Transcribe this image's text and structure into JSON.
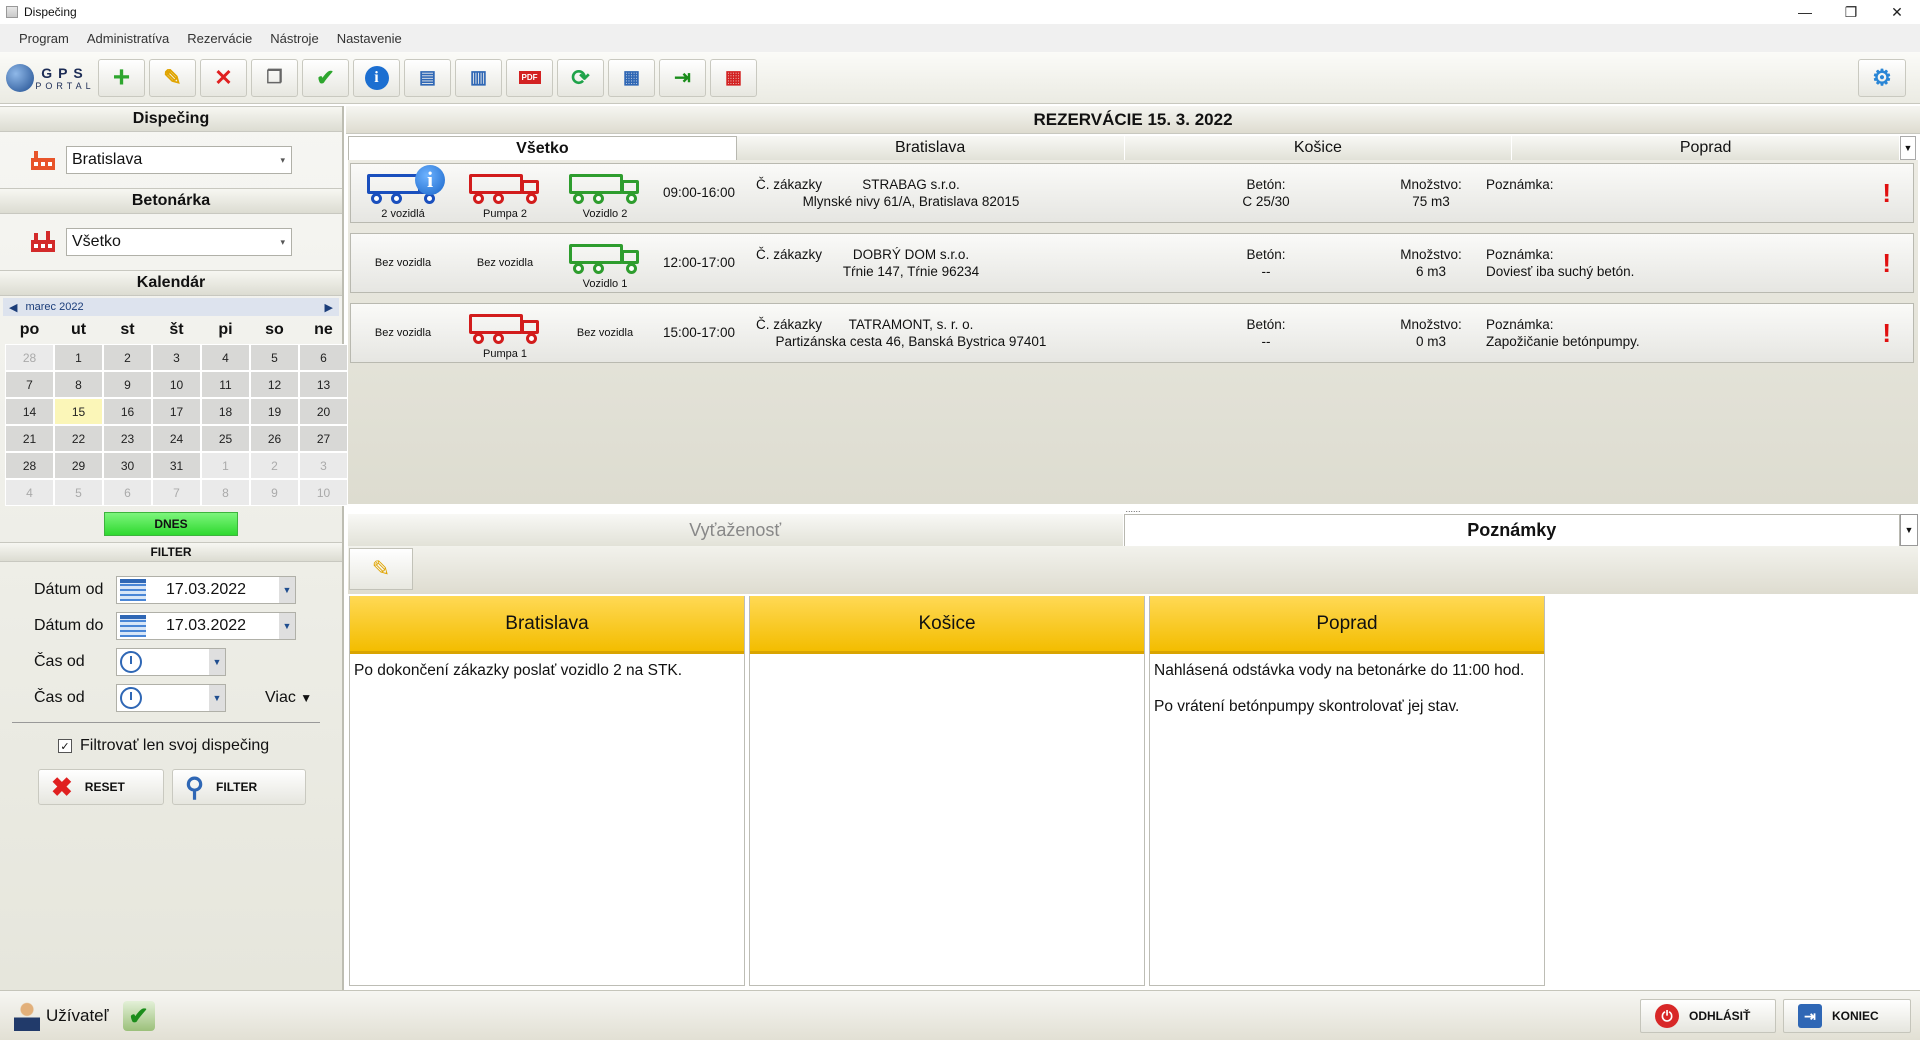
{
  "window": {
    "title": "Dispečing",
    "minimize": "—",
    "restore": "❐",
    "close": "✕"
  },
  "menu": [
    "Program",
    "Administratíva",
    "Rezervácie",
    "Nástroje",
    "Nastavenie"
  ],
  "logo": {
    "line1": "GPS",
    "line2": "PORTAL"
  },
  "toolbar": {
    "icons": [
      "add-icon",
      "edit-icon",
      "delete-icon",
      "copy-icon",
      "confirm-icon",
      "info-icon",
      "export-icon",
      "import-icon",
      "pdf-icon",
      "refresh-icon",
      "calendar-icon",
      "exit-icon",
      "date-icon"
    ],
    "settings_icon": "gear-icon"
  },
  "left": {
    "dispecing_title": "Dispečing",
    "dispecing_value": "Bratislava",
    "betonarka_title": "Betonárka",
    "betonarka_value": "Všetko",
    "kalendar_title": "Kalendár",
    "month_label": "marec 2022",
    "weekdays": [
      "po",
      "ut",
      "st",
      "št",
      "pi",
      "so",
      "ne"
    ],
    "days": [
      [
        "28",
        "1",
        "2",
        "3",
        "4",
        "5",
        "6"
      ],
      [
        "7",
        "8",
        "9",
        "10",
        "11",
        "12",
        "13"
      ],
      [
        "14",
        "15",
        "16",
        "17",
        "18",
        "19",
        "20"
      ],
      [
        "21",
        "22",
        "23",
        "24",
        "25",
        "26",
        "27"
      ],
      [
        "28",
        "29",
        "30",
        "31",
        "1",
        "2",
        "3"
      ],
      [
        "4",
        "5",
        "6",
        "7",
        "8",
        "9",
        "10"
      ]
    ],
    "today_button": "DNES",
    "filter_title": "FILTER",
    "datum_od_label": "Dátum od",
    "datum_od_value": "17.03.2022",
    "datum_do_label": "Dátum do",
    "datum_do_value": "17.03.2022",
    "cas_od_label_1": "Čas od",
    "cas_od_label_2": "Čas od",
    "viac_label": "Viac",
    "checkbox_label": "Filtrovať len svoj dispečing",
    "checkbox_checked": true,
    "reset_label": "RESET",
    "filter_label": "FILTER"
  },
  "main": {
    "header": "REZERVÁCIE 15. 3. 2022",
    "tabs": [
      "Všetko",
      "Bratislava",
      "Košice",
      "Poprad"
    ],
    "reservations": [
      {
        "vehicle1": "2 vozidlá",
        "vehicle2": "Pumpa 2",
        "vehicle3": "Vozidlo 2",
        "time": "09:00-16:00",
        "order_label": "Č. zákazky",
        "company": "STRABAG s.r.o.",
        "address": "Mlynské nivy 61/A, Bratislava 82015",
        "beton_label": "Betón:",
        "beton_value": "C 25/30",
        "mnozstvo_label": "Množstvo:",
        "mnozstvo_value": "75 m3",
        "poznamka_label": "Poznámka:",
        "poznamka_value": "",
        "flag": "!"
      },
      {
        "vehicle1": "Bez vozidla",
        "vehicle2": "Bez vozidla",
        "vehicle3": "Vozidlo 1",
        "time": "12:00-17:00",
        "order_label": "Č. zákazky",
        "company": "DOBRÝ DOM s.r.o.",
        "address": "Tŕnie 147, Tŕnie 96234",
        "beton_label": "Betón:",
        "beton_value": "--",
        "mnozstvo_label": "Množstvo:",
        "mnozstvo_value": "6 m3",
        "poznamka_label": "Poznámka:",
        "poznamka_value": "Doviesť iba suchý betón.",
        "flag": "!"
      },
      {
        "vehicle1": "Bez vozidla",
        "vehicle2": "Pumpa 1",
        "vehicle3": "Bez vozidla",
        "time": "15:00-17:00",
        "order_label": "Č. zákazky",
        "company": "TATRAMONT, s. r. o.",
        "address": "Partizánska cesta 46, Banská Bystrica 97401",
        "beton_label": "Betón:",
        "beton_value": "--",
        "mnozstvo_label": "Množstvo:",
        "mnozstvo_value": "0 m3",
        "poznamka_label": "Poznámka:",
        "poznamka_value": "Zapožičanie betónpumpy.",
        "flag": "!"
      }
    ],
    "splitter": "......",
    "bottom_tabs": [
      "Vyťaženosť",
      "Poznámky"
    ],
    "notes": [
      {
        "title": "Bratislava",
        "lines": [
          "Po dokončení zákazky poslať vozidlo 2 na STK."
        ]
      },
      {
        "title": "Košice",
        "lines": []
      },
      {
        "title": "Poprad",
        "lines": [
          "Nahlásená odstávka vody na betonárke do 11:00 hod.",
          "Po vrátení betónpumpy skontrolovať jej stav."
        ]
      }
    ]
  },
  "bottom": {
    "user_label": "Užívateľ",
    "logout_label": "ODHLÁSIŤ",
    "exit_label": "KONIEC"
  },
  "colors": {
    "accent_yellow": "#f3bd00",
    "vehicle_blue": "#1a4fbd",
    "vehicle_red": "#d21c1c",
    "vehicle_green": "#2e9d2e",
    "today_green": "#2fd92f"
  }
}
